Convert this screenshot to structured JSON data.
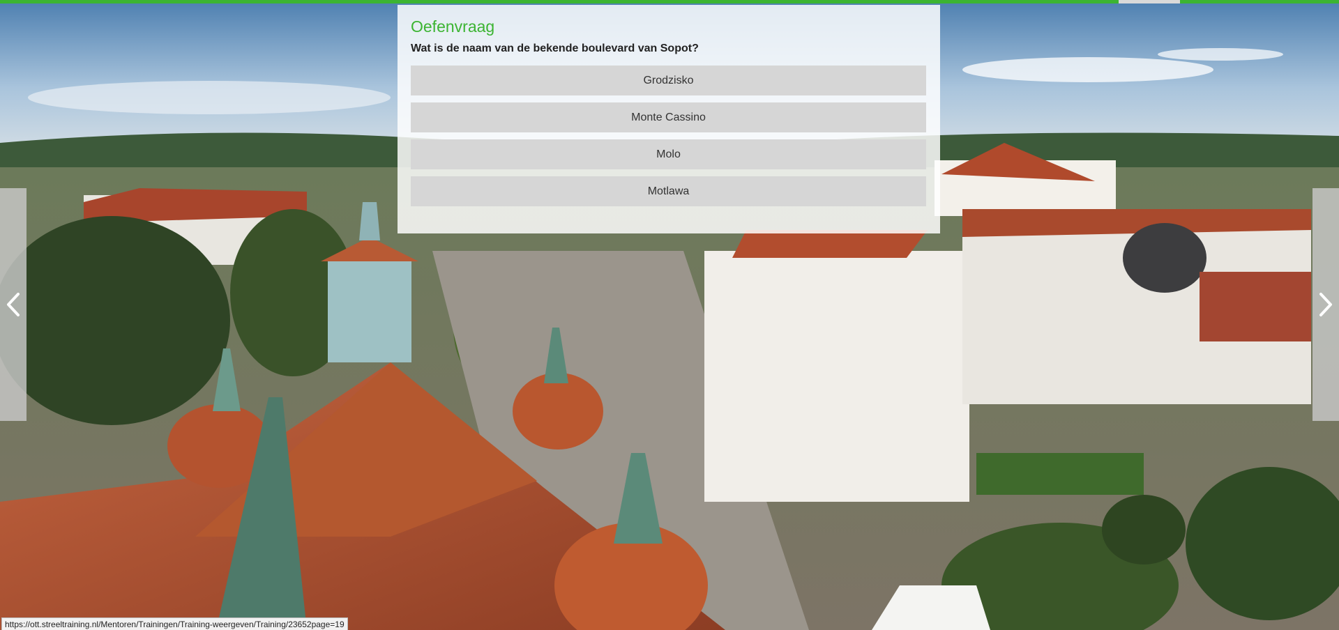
{
  "progress": {
    "fraction": 0.835,
    "color": "#3cb432"
  },
  "quiz": {
    "title": "Oefenvraag",
    "question": "Wat is de naam van de bekende boulevard van Sopot?",
    "answers": [
      {
        "label": "Grodzisko"
      },
      {
        "label": "Monte Cassino"
      },
      {
        "label": "Molo"
      },
      {
        "label": "Motlawa"
      }
    ]
  },
  "navigation": {
    "prev_icon": "chevron-left-icon",
    "next_icon": "chevron-right-icon"
  },
  "status_bar": {
    "url": "https://ott.streeltraining.nl/Mentoren/Trainingen/Training-weergeven/Training/23652page=19"
  },
  "colors": {
    "accent": "#3cb432",
    "answer_bg": "#d6d6d6"
  }
}
